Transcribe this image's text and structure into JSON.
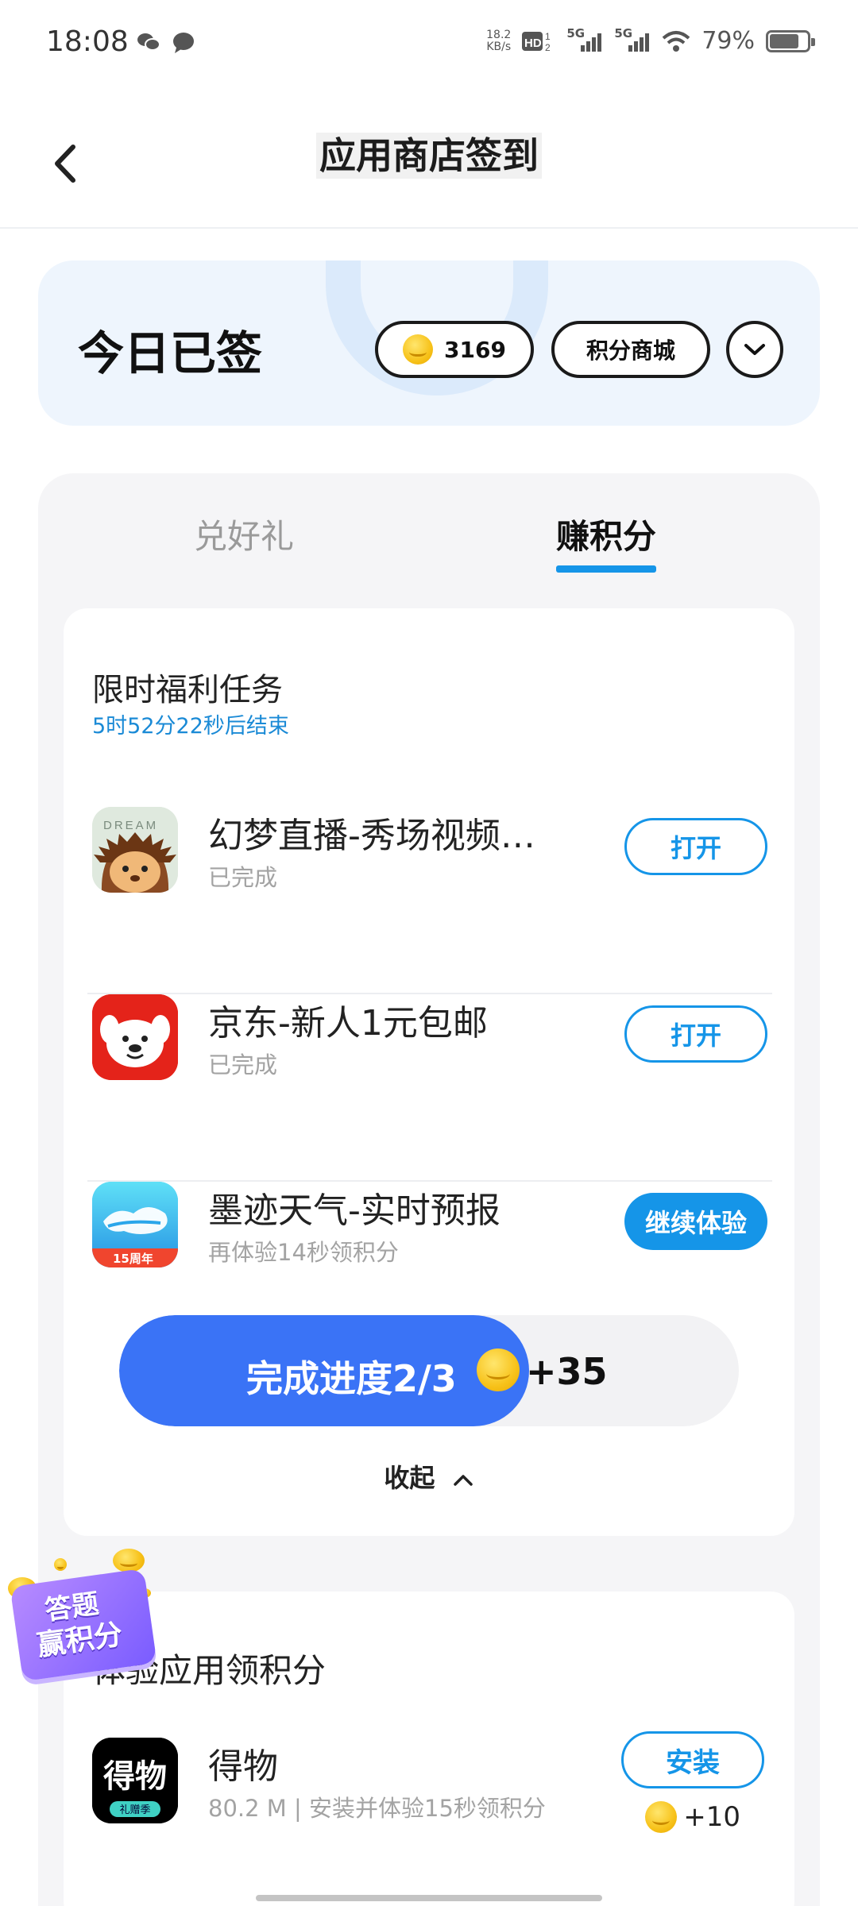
{
  "status_bar": {
    "time": "18:08",
    "net_speed_value": "18.2",
    "net_speed_unit": "KB/s",
    "network_1": "5G",
    "network_2": "5G",
    "battery_percent": "79%",
    "battery_level": 0.79,
    "icons": [
      "wechat-icon",
      "message-icon",
      "hd-icon",
      "signal-icon",
      "wifi-icon",
      "battery-icon"
    ]
  },
  "header": {
    "title": "应用商店签到",
    "back_icon": "chevron-left-icon"
  },
  "sign_card": {
    "status": "今日已签",
    "points": "3169",
    "mall_label": "积分商城",
    "expand_icon": "chevron-down-icon"
  },
  "tabs": [
    {
      "label": "兑好礼",
      "active": false
    },
    {
      "label": "赚积分",
      "active": true
    }
  ],
  "limited_tasks": {
    "title": "限时福利任务",
    "countdown": "5时52分22秒后结束",
    "items": [
      {
        "name": "幻梦直播-秀场视频…",
        "status": "已完成",
        "action": "打开",
        "icon": "dream-live-app-icon"
      },
      {
        "name": "京东-新人1元包邮",
        "status": "已完成",
        "action": "打开",
        "icon": "jd-app-icon"
      },
      {
        "name": "墨迹天气-实时预报",
        "status": "再体验14秒领积分",
        "action": "继续体验",
        "icon": "moji-weather-app-icon"
      }
    ],
    "progress_label": "完成进度2/3",
    "progress_fraction": 0.667,
    "reward": "+35",
    "collapse_label": "收起"
  },
  "experience": {
    "title": "体验应用领积分",
    "items": [
      {
        "name": "得物",
        "detail": "80.2 M | 安装并体验15秒领积分",
        "action": "安装",
        "reward": "+10",
        "icon_text": "得物",
        "icon_badge": "礼赠季"
      }
    ]
  },
  "floating_badge": {
    "line1": "答题",
    "line2": "赢积分"
  },
  "app_icon_texts": {
    "dream": "DREAM",
    "moji_badge": "15周年"
  },
  "colors": {
    "accent": "#1595e8",
    "progress_fill": "#3a73f6",
    "countdown": "#1a8ad6",
    "sign_card_bg": "#eef5fd",
    "panel_bg": "#f5f5f7"
  }
}
